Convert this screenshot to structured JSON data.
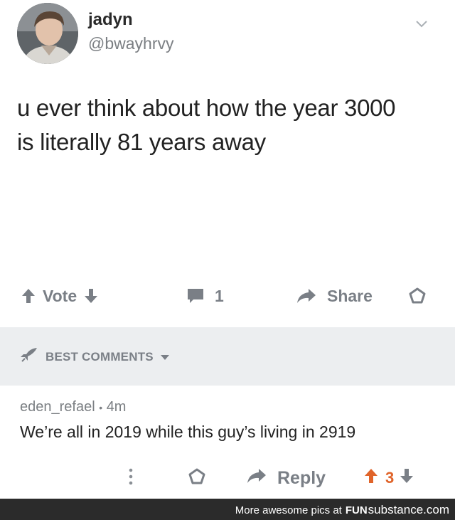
{
  "tweet": {
    "username": "jadyn",
    "handle": "@bwayhrvy",
    "text_line1": "u ever think about how the year 3000",
    "text_line2": "is literally 81 years away"
  },
  "actions": {
    "vote_label": "Vote",
    "comment_count": "1",
    "share_label": "Share"
  },
  "best_comments": {
    "label": "BEST COMMENTS"
  },
  "comment": {
    "author": "eden_refael",
    "separator": "•",
    "age": "4m",
    "text": "We’re all in 2019 while this guy’s living in 2919",
    "reply_label": "Reply",
    "score": "3"
  },
  "footer": {
    "prefix": "More awesome pics at",
    "brand_bold": "FUN",
    "brand_regular": "substance.com"
  },
  "colors": {
    "muted": "#7a7f86",
    "upvote_active": "#e0642a",
    "section_bg": "#eceef0",
    "footer_bg": "#2b2b2b"
  }
}
